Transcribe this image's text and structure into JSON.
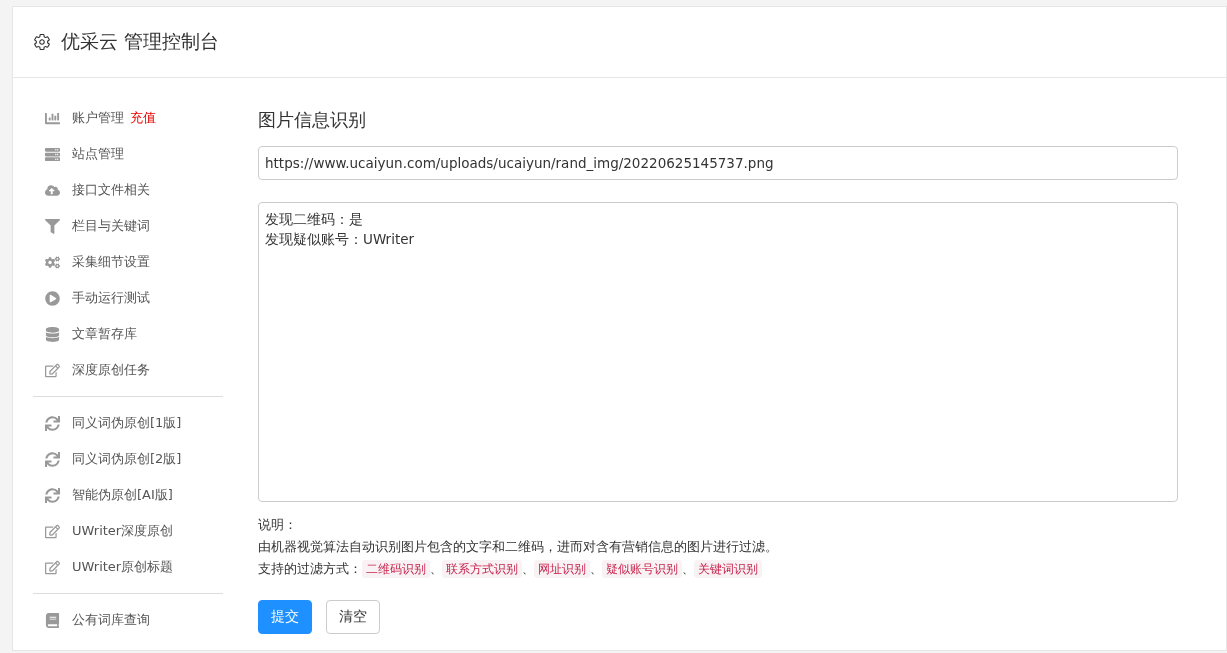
{
  "header": {
    "title": "优采云 管理控制台"
  },
  "sidebar": {
    "groups": [
      [
        {
          "label": "账户管理",
          "badge": "充值"
        },
        {
          "label": "站点管理"
        },
        {
          "label": "接口文件相关"
        },
        {
          "label": "栏目与关键词"
        },
        {
          "label": "采集细节设置"
        },
        {
          "label": "手动运行测试"
        },
        {
          "label": "文章暂存库"
        },
        {
          "label": "深度原创任务"
        }
      ],
      [
        {
          "label": "同义词伪原创[1版]"
        },
        {
          "label": "同义词伪原创[2版]"
        },
        {
          "label": "智能伪原创[AI版]"
        },
        {
          "label": "UWriter深度原创"
        },
        {
          "label": "UWriter原创标题"
        }
      ],
      [
        {
          "label": "公有词库查询"
        }
      ]
    ]
  },
  "main": {
    "title": "图片信息识别",
    "url": "https://www.ucaiyun.com/uploads/ucaiyun/rand_img/20220625145737.png",
    "result": [
      "发现二维码：是",
      "发现疑似账号：UWriter"
    ],
    "notes_title": "说明：",
    "description": "由机器视觉算法自动识别图片包含的文字和二维码，进而对含有营销信息的图片进行过滤。",
    "methods_label": "支持的过滤方式：",
    "methods": [
      "二维码识别",
      "联系方式识别",
      "网址识别",
      "疑似账号识别",
      "关键词识别"
    ],
    "separator": "、",
    "buttons": [
      {
        "label": "提交",
        "kind": "primary"
      },
      {
        "label": "清空",
        "kind": "default"
      }
    ]
  }
}
